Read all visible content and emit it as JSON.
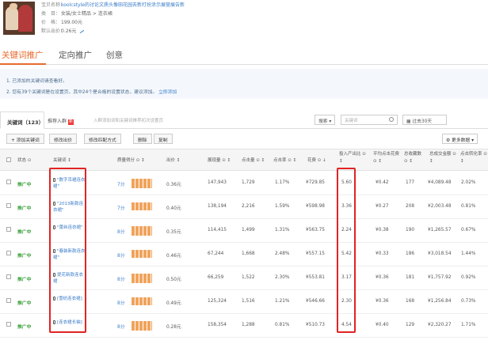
{
  "product": {
    "lines": [
      {
        "key": "宝贝名称：",
        "value": "koolcstyle的讨论文质头像田花园去新打扮涂示展营展告新",
        "link": true
      },
      {
        "key": "类　目：",
        "value": "女装/女士精品 > 连衣裙",
        "link": false
      },
      {
        "key": "价　格：",
        "value": "199.00元",
        "link": false
      },
      {
        "key": "默认出价：",
        "value": "0.26元",
        "link": false
      }
    ]
  },
  "tabs": [
    {
      "label": "关键词推广"
    },
    {
      "label": "定向推广"
    },
    {
      "label": "创意"
    }
  ],
  "notices": [
    {
      "text": "1. 已添加的关键词请查看好。"
    },
    {
      "text": "2. 您有39个关键词是在设置页，其中24个是合格的设置状态，建议添加。",
      "link": "立即添加"
    }
  ],
  "toolbar": {
    "kw_tab": "关键词（123）",
    "add_tab": "推荐入群",
    "add_badge": "新",
    "hint": "入群添加词和关键词推荐初次设置页",
    "dropdown": "搜索 ▾",
    "search_placeholder": "关键词",
    "period": "▦ 过去30天"
  },
  "actions": {
    "add": "+ 添加关键词",
    "bid": "修改出价",
    "match": "修改匹配方式",
    "delete": "删除",
    "copy": "复制",
    "more": "⚙ 更多数据 ▾"
  },
  "columns": [
    {
      "label": "状态 ⊙"
    },
    {
      "label": "关键词 ↕"
    },
    {
      "label": "质量得分 ⊙ ↕"
    },
    {
      "label": "出价 ↕"
    },
    {
      "label": "展现量 ⊙ ↕"
    },
    {
      "label": "点击量 ⊙ ↕"
    },
    {
      "label": "点击率 ⊙ ↕"
    },
    {
      "label": "花费 ⊙ ↓"
    },
    {
      "label": "投入产出比 ⊙ ↕"
    },
    {
      "label": "平均点击花费 ⊙ ↕"
    },
    {
      "label": "总收藏数 ⊙ ↕"
    },
    {
      "label": "总成交金额 ⊙ ↕"
    },
    {
      "label": "点击转化率 ⊙ ↕"
    }
  ],
  "rows": [
    {
      "status": "推广中",
      "kw": "\"数字吊裙连衣裙\"",
      "qs": "7分",
      "bid": "0.36元",
      "impr": "147,943",
      "clicks": "1,729",
      "ctr": "1.17%",
      "cost": "¥729.85",
      "roi": "5.60",
      "cpc": "¥0.42",
      "fav": "177",
      "gmv": "¥4,089.48",
      "cvr": "2.02%"
    },
    {
      "status": "推广中",
      "kw": "\"2013新款连衣裙\"",
      "qs": "7分",
      "bid": "0.40元",
      "impr": "138,194",
      "clicks": "2,216",
      "ctr": "1.59%",
      "cost": "¥598.98",
      "roi": "3.36",
      "cpc": "¥0.27",
      "fav": "208",
      "gmv": "¥2,003.48",
      "cvr": "0.81%"
    },
    {
      "status": "推广中",
      "kw": "\"蕾丝连衣裙\"",
      "qs": "8分",
      "bid": "0.35元",
      "impr": "114,415",
      "clicks": "1,499",
      "ctr": "1.31%",
      "cost": "¥563.75",
      "roi": "2.24",
      "cpc": "¥0.38",
      "fav": "190",
      "gmv": "¥1,265.57",
      "cvr": "0.67%"
    },
    {
      "status": "推广中",
      "kw": "\"春装新款连衣裙\"",
      "qs": "8分",
      "bid": "0.46元",
      "impr": "67,244",
      "clicks": "1,668",
      "ctr": "2.48%",
      "cost": "¥557.15",
      "roi": "5.42",
      "cpc": "¥0.33",
      "fav": "186",
      "gmv": "¥3,018.54",
      "cvr": "1.44%"
    },
    {
      "status": "推广中",
      "kw": "提花新款连衣裙",
      "qs": "8分",
      "bid": "0.50元",
      "impr": "66,259",
      "clicks": "1,522",
      "ctr": "2.30%",
      "cost": "¥553.81",
      "roi": "3.17",
      "cpc": "¥0.36",
      "fav": "181",
      "gmv": "¥1,757.92",
      "cvr": "0.92%"
    },
    {
      "status": "推广中",
      "kw": "[雪纺连衣裙]",
      "qs": "8分",
      "bid": "0.49元",
      "impr": "125,324",
      "clicks": "1,516",
      "ctr": "1.21%",
      "cost": "¥546.66",
      "roi": "2.30",
      "cpc": "¥0.36",
      "fav": "168",
      "gmv": "¥1,256.84",
      "cvr": "0.73%"
    },
    {
      "status": "推广中",
      "kw": "[连衣裙长袖]",
      "qs": "8分",
      "bid": "0.28元",
      "impr": "158,354",
      "clicks": "1,288",
      "ctr": "0.81%",
      "cost": "¥510.73",
      "roi": "4.54",
      "cpc": "¥0.40",
      "fav": "129",
      "gmv": "¥2,320.27",
      "cvr": "1.71%"
    }
  ],
  "colors": {
    "accent": "#e86a2d",
    "status": "#3aa03a",
    "link": "#3a7dc9",
    "highlight": "#e02424"
  }
}
